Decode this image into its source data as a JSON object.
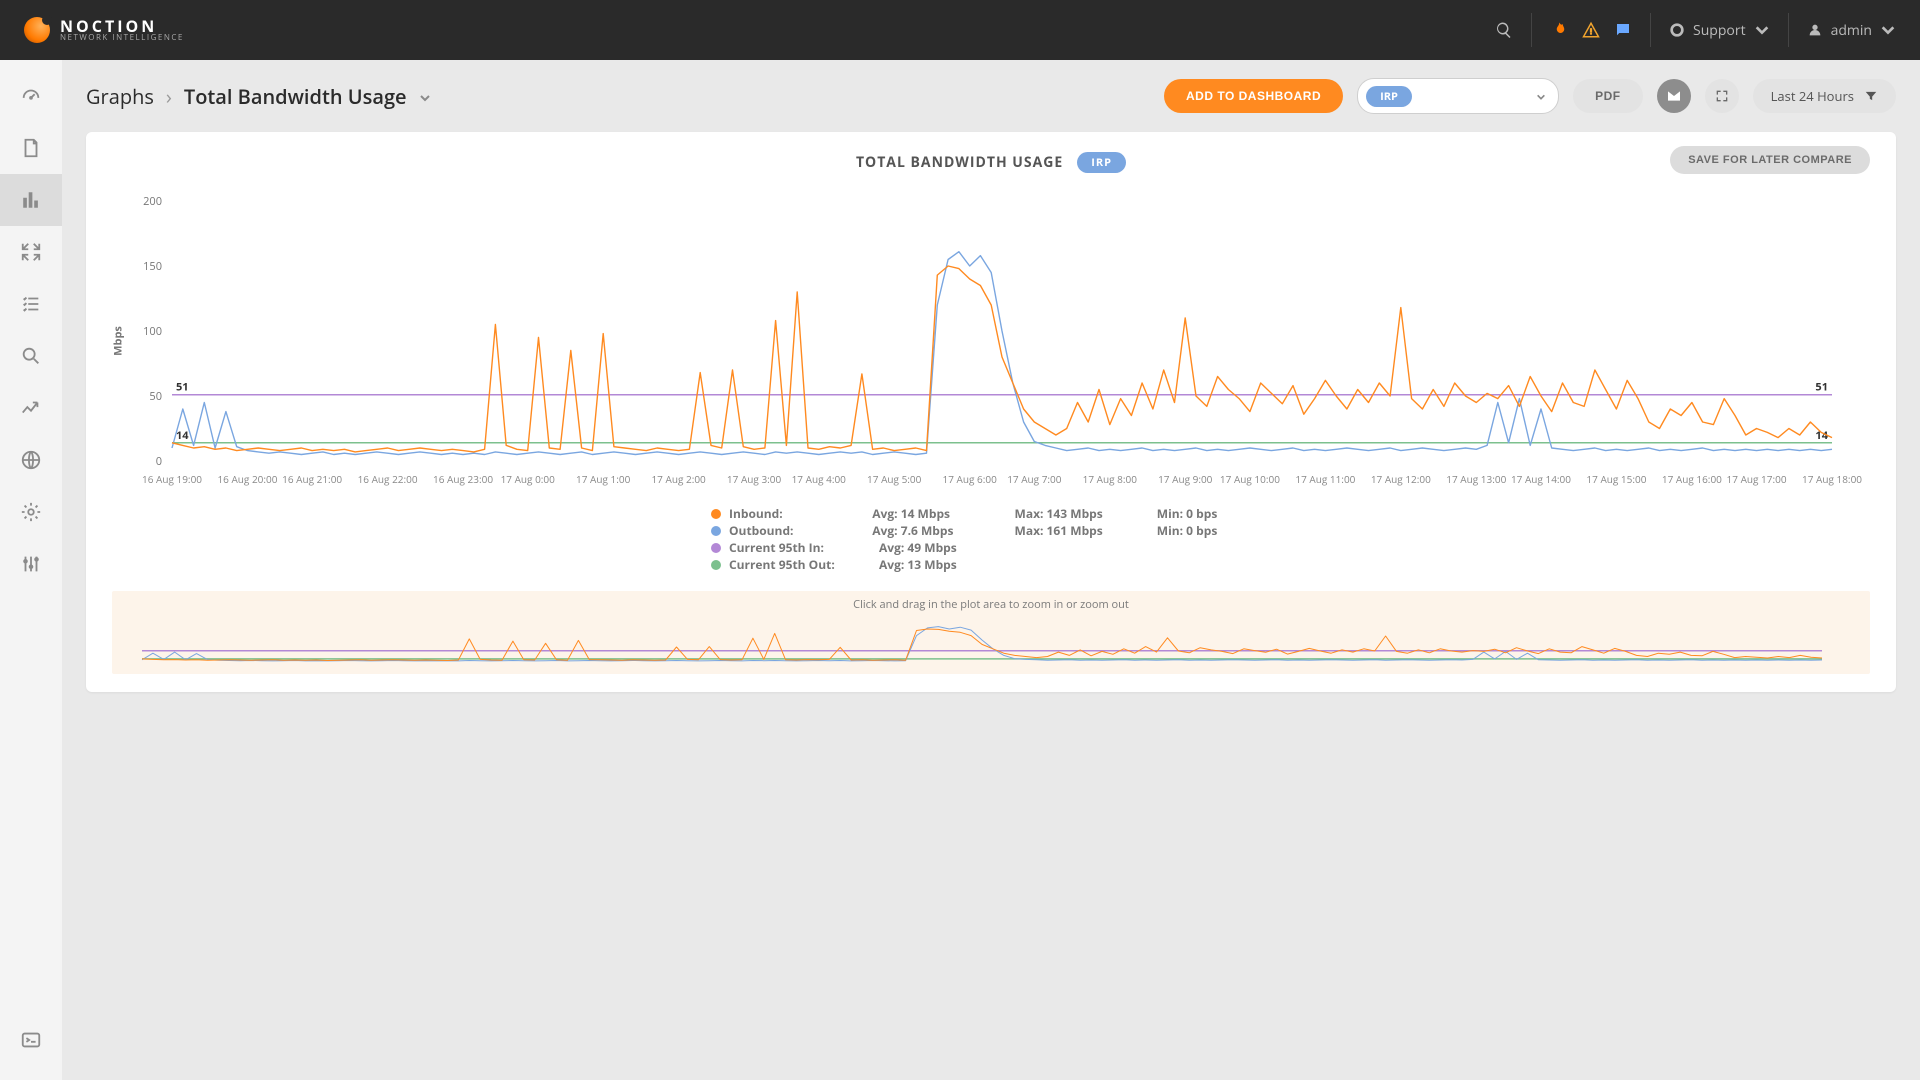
{
  "brand": {
    "name": "NOCTION",
    "tagline": "NETWORK INTELLIGENCE"
  },
  "nav": {
    "support": "Support",
    "user": "admin"
  },
  "breadcrumb": {
    "root": "Graphs",
    "page": "Total Bandwidth Usage"
  },
  "header": {
    "add_dashboard": "ADD TO DASHBOARD",
    "selector": "IRP",
    "pdf": "PDF",
    "time_range": "Last 24 Hours"
  },
  "card": {
    "title": "TOTAL BANDWIDTH USAGE",
    "badge": "IRP",
    "save": "SAVE FOR LATER COMPARE"
  },
  "chart_meta": {
    "ylabel": "Mbps",
    "marker_in": "51",
    "marker_out": "14",
    "zoom_hint": "Click and drag in the plot area to zoom in or zoom out"
  },
  "legend": {
    "inbound": {
      "name": "Inbound:",
      "avg": "Avg: 14 Mbps",
      "max": "Max: 143 Mbps",
      "min": "Min: 0 bps"
    },
    "outbound": {
      "name": "Outbound:",
      "avg": "Avg: 7.6 Mbps",
      "max": "Max: 161 Mbps",
      "min": "Min: 0 bps"
    },
    "p95in": {
      "name": "Current 95th In:",
      "avg": "Avg: 49 Mbps"
    },
    "p95out": {
      "name": "Current 95th Out:",
      "avg": "Avg: 13 Mbps"
    }
  },
  "chart_data": {
    "type": "line",
    "title": "TOTAL BANDWIDTH USAGE",
    "xlabel": "",
    "ylabel": "Mbps",
    "ylim": [
      0,
      200
    ],
    "yticks": [
      0,
      50,
      100,
      150,
      200
    ],
    "x_categories": [
      "16 Aug 19:00",
      "16 Aug 20:00",
      "16 Aug 21:00",
      "16 Aug 22:00",
      "16 Aug 23:00",
      "17 Aug 0:00",
      "17 Aug 1:00",
      "17 Aug 2:00",
      "17 Aug 3:00",
      "17 Aug 4:00",
      "17 Aug 5:00",
      "17 Aug 6:00",
      "17 Aug 7:00",
      "17 Aug 8:00",
      "17 Aug 9:00",
      "17 Aug 10:00",
      "17 Aug 11:00",
      "17 Aug 12:00",
      "17 Aug 13:00",
      "17 Aug 14:00",
      "17 Aug 15:00",
      "17 Aug 16:00",
      "17 Aug 17:00",
      "17 Aug 18:00"
    ],
    "reference_lines": [
      {
        "name": "Current 95th In",
        "value": 51,
        "color": "#b388d6"
      },
      {
        "name": "Current 95th Out",
        "value": 14,
        "color": "#7cc08e"
      }
    ],
    "series": [
      {
        "name": "Inbound",
        "color": "#ff8a20",
        "stats": {
          "avg_mbps": 14,
          "max_mbps": 143,
          "min_bps": 0
        },
        "values": [
          14,
          12,
          10,
          11,
          9,
          10,
          8,
          9,
          10,
          9,
          8,
          9,
          10,
          8,
          9,
          8,
          9,
          7,
          8,
          9,
          10,
          8,
          9,
          10,
          9,
          8,
          9,
          8,
          7,
          9,
          105,
          12,
          9,
          8,
          95,
          10,
          9,
          85,
          10,
          8,
          98,
          11,
          10,
          9,
          8,
          10,
          9,
          8,
          9,
          68,
          12,
          10,
          70,
          11,
          9,
          10,
          108,
          12,
          130,
          10,
          9,
          11,
          10,
          12,
          67,
          9,
          10,
          8,
          9,
          10,
          8,
          143,
          150,
          148,
          140,
          135,
          120,
          80,
          60,
          40,
          30,
          25,
          20,
          25,
          45,
          30,
          55,
          28,
          48,
          35,
          60,
          40,
          70,
          45,
          110,
          50,
          42,
          65,
          55,
          48,
          38,
          60,
          52,
          44,
          58,
          36,
          48,
          62,
          50,
          40,
          55,
          45,
          60,
          50,
          118,
          48,
          40,
          55,
          42,
          60,
          50,
          45,
          52,
          48,
          58,
          42,
          65,
          50,
          38,
          60,
          45,
          42,
          70,
          55,
          40,
          62,
          48,
          30,
          25,
          40,
          35,
          45,
          30,
          28,
          48,
          35,
          20,
          25,
          22,
          18,
          25,
          20,
          30,
          22,
          18
        ]
      },
      {
        "name": "Outbound",
        "color": "#7aa6e0",
        "stats": {
          "avg_mbps": 7.6,
          "max_mbps": 161,
          "min_bps": 0
        },
        "values": [
          10,
          40,
          12,
          45,
          10,
          38,
          11,
          8,
          7,
          6,
          7,
          6,
          5,
          6,
          7,
          5,
          6,
          5,
          6,
          7,
          6,
          5,
          6,
          7,
          6,
          5,
          6,
          5,
          6,
          5,
          7,
          6,
          5,
          6,
          7,
          6,
          5,
          6,
          7,
          5,
          6,
          7,
          6,
          5,
          6,
          7,
          6,
          5,
          6,
          7,
          6,
          5,
          6,
          7,
          6,
          5,
          7,
          6,
          7,
          6,
          5,
          6,
          7,
          6,
          7,
          5,
          6,
          7,
          6,
          5,
          6,
          120,
          155,
          161,
          150,
          158,
          145,
          100,
          60,
          30,
          15,
          12,
          10,
          8,
          9,
          10,
          8,
          9,
          8,
          9,
          10,
          8,
          9,
          8,
          9,
          10,
          8,
          9,
          8,
          9,
          10,
          9,
          8,
          9,
          10,
          8,
          9,
          8,
          9,
          10,
          9,
          8,
          9,
          10,
          8,
          9,
          10,
          9,
          8,
          9,
          10,
          9,
          12,
          45,
          14,
          48,
          12,
          40,
          10,
          9,
          8,
          9,
          10,
          8,
          9,
          8,
          9,
          10,
          8,
          9,
          8,
          9,
          10,
          8,
          9,
          8,
          9,
          8,
          9,
          8,
          9,
          8,
          9,
          8,
          9
        ]
      }
    ]
  }
}
